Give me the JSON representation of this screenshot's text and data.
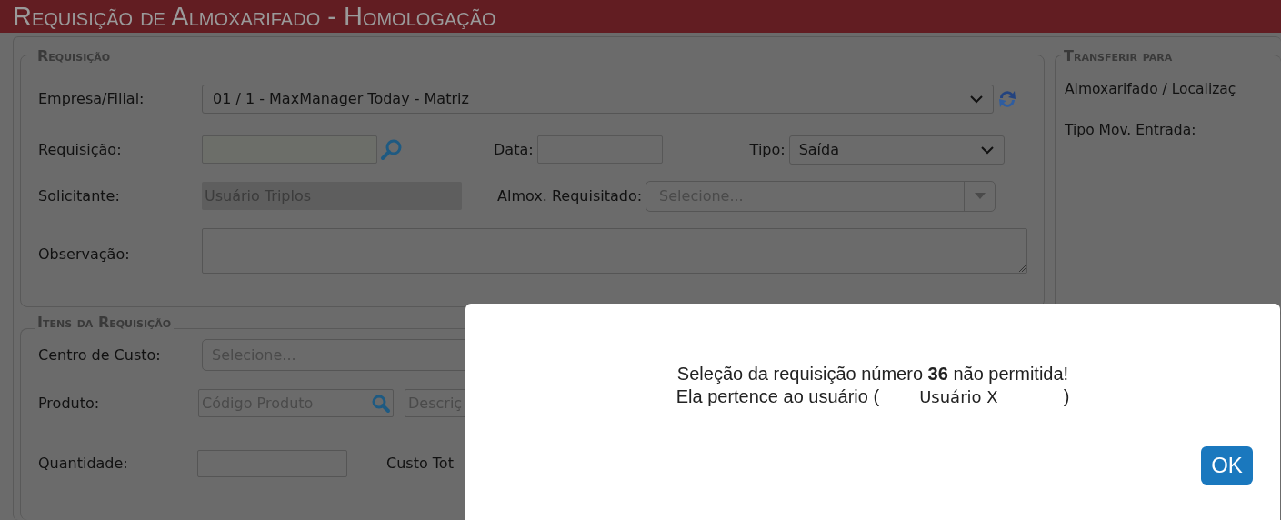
{
  "header": {
    "title": "Requisição de Almoxarifado - Homologação"
  },
  "requisicao": {
    "title": "Requisição",
    "empresa": {
      "label": "Empresa/Filial:",
      "value": "01 / 1 - MaxManager Today - Matriz"
    },
    "requisicao": {
      "label": "Requisição:"
    },
    "data": {
      "label": "Data:"
    },
    "tipo": {
      "label": "Tipo:",
      "value": "Saída"
    },
    "solicitante": {
      "label": "Solicitante:",
      "value": "Usuário Triplos"
    },
    "almox": {
      "label": "Almox. Requisitado:",
      "placeholder": "Selecione..."
    },
    "observacao": {
      "label": "Observação:"
    }
  },
  "itens": {
    "title": "Itens da Requisição",
    "centro_custo": {
      "label": "Centro de Custo:",
      "placeholder": "Selecione..."
    },
    "produto": {
      "label": "Produto:",
      "code_placeholder": "Código Produto",
      "description_placeholder": "Descriç"
    },
    "quantidade": {
      "label": "Quantidade:"
    },
    "custo_total": {
      "label": "Custo Tot"
    }
  },
  "transferir": {
    "title": "Transferir para",
    "labels": [
      "Almoxarifado / Localizaç",
      "Tipo Mov. Entrada:"
    ]
  },
  "dialog": {
    "line1": "Seleção da requisição número **36** não permitida!",
    "line2": {
      "before": "Ela pertence ao usuário (",
      "user": "Usuário X",
      "after": ")"
    },
    "button": "OK"
  }
}
